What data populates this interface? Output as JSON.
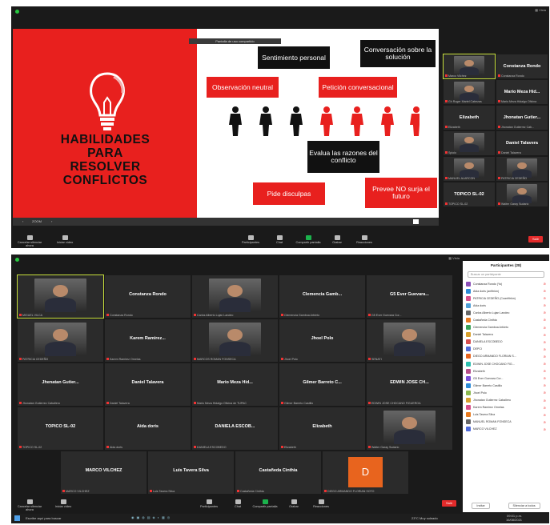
{
  "top": {
    "banner": "Pantalla de uso compartido",
    "slide": {
      "title_lines": [
        "HABILIDADES",
        "PARA",
        "RESOLVER",
        "CONFLICTOS"
      ],
      "boxes": {
        "sentimiento": "Sentimiento personal",
        "conversacion": "Conversación sobre la solución",
        "observacion": "Observación neutral",
        "peticion": "Petición conversacional",
        "evalua": "Evalua las razones del conflicto",
        "pide": "Pide disculpas",
        "prevee": "Prevee NO surja el futuro"
      }
    },
    "slidebar": {
      "zoom": "ZOOM"
    },
    "side_tiles": [
      {
        "name": "",
        "sub": "Marco Vilchez"
      },
      {
        "name": "Constanza Rondo",
        "sub": "Constanza Rondo"
      },
      {
        "name": "",
        "sub": "Gh Roger Martel Cabezas"
      },
      {
        "name": "Mario Meza Hid...",
        "sub": "Mario Meza Hidalgo Oficina"
      },
      {
        "name": "Elizabeth",
        "sub": "Elizabeth"
      },
      {
        "name": "Jhonatan Gutier...",
        "sub": "Jhonatan Gutierrez Cab..."
      },
      {
        "name": "",
        "sub": "Spiolo"
      },
      {
        "name": "Daniel Talavera",
        "sub": "Daniel Talavera"
      },
      {
        "name": "",
        "sub": "MANUEL ALARCON"
      },
      {
        "name": "",
        "sub": "PATRICIA CEDEÑO"
      },
      {
        "name": "TOPICO SL-02",
        "sub": "TOPICO SL-02"
      },
      {
        "name": "",
        "sub": "Walter Garay Sudario"
      }
    ],
    "toolbar": {
      "unmute": "Cancelar silenciar ahora",
      "start_video": "Iniciar vídeo",
      "participants": "Participantes",
      "chat": "Chat",
      "share": "Compartir pantalla",
      "record": "Grabar",
      "reactions": "Reacciones",
      "end": "Salir"
    }
  },
  "bottom": {
    "view": "Vista",
    "tiles": [
      {
        "name": "",
        "sub": "MIGUEL VILCA",
        "photo": true
      },
      {
        "name": "Constanza Rondo",
        "sub": "Constanza Rondo"
      },
      {
        "name": "",
        "sub": "Carlos Alberto Lujan Landeo",
        "photo": true
      },
      {
        "name": "Clemencia Gamb...",
        "sub": "Clemencia Gamboa Arbieto"
      },
      {
        "name": "G5 Ever Guevara...",
        "sub": "G5 Ever Guevara Cor..."
      },
      {
        "name": "",
        "sub": "PATRICIA CEDEÑO",
        "photo": true
      },
      {
        "name": "Karem Ramirez...",
        "sub": "Karem Ramirez Ornelas"
      },
      {
        "name": "",
        "sub": "MARCOS ROMAN FONSECA",
        "photo": true
      },
      {
        "name": "Jhoel Polo",
        "sub": "Jhoel Polo"
      },
      {
        "name": "",
        "sub": "SENATI",
        "photo": true
      },
      {
        "name": "Jhenatan Gutier...",
        "sub": "Jhonatan Gutierrez Caballero"
      },
      {
        "name": "Daniel Talavera",
        "sub": "Daniel Talavera"
      },
      {
        "name": "Mario Meza Hid...",
        "sub": "Mario Meza Hidalgo Oficina de TUPAC"
      },
      {
        "name": "Gilmer Barreto C...",
        "sub": "Gilmer Barreto Castillo"
      },
      {
        "name": "EDWIN JOSE CH...",
        "sub": "EDWIN JOSE CHOCANO FIGUEROA"
      },
      {
        "name": "TOPICO SL-02",
        "sub": "TOPICO SL-02"
      },
      {
        "name": "Aida doris",
        "sub": "Aida doris"
      },
      {
        "name": "DANIELA ESCOB...",
        "sub": "DANIELA ESCOBEDO"
      },
      {
        "name": "Elizabeth",
        "sub": "Elizabeth"
      },
      {
        "name": "",
        "sub": "Walter Garay Sudario",
        "photo": true
      },
      {
        "name": "MARCO VILCHEZ",
        "sub": "MARCO VILCHEZ"
      },
      {
        "name": "Luis Tavera Silva",
        "sub": "Luis Tavera Silva"
      },
      {
        "name": "Castañeda Cinthia",
        "sub": "Castañeda Cinthia"
      },
      {
        "name": "",
        "sub": "DIEGO ARMANDO FLORIAN SOTO",
        "letter": "D"
      }
    ],
    "panel": {
      "title": "Participantes (28)",
      "search": "Buscar un participante",
      "participants": [
        {
          "name": "Constanza Rondo (Yo)",
          "color": "#8b4fb8"
        },
        {
          "name": "Aida doris (anfitrión)",
          "color": "#2d8cd8"
        },
        {
          "name": "PATRICIA CEDEÑO (Coanfitrión)",
          "color": "#d84f8b"
        },
        {
          "name": "Aida doris",
          "color": "#4fa0d8"
        },
        {
          "name": "Carlos Alberto Lujan Landeo",
          "color": "#666"
        },
        {
          "name": "Castañeda Cinthia",
          "color": "#e87a1e"
        },
        {
          "name": "Clemencia Gamboa Arbieto",
          "color": "#3aa35a"
        },
        {
          "name": "Daniel Talavera",
          "color": "#d8a02d"
        },
        {
          "name": "DANIELA ESCOBEDO",
          "color": "#d84f4f"
        },
        {
          "name": "DEPCI",
          "color": "#4f6ad8"
        },
        {
          "name": "DIEGO ARMANDO FLORIAN S...",
          "color": "#e8641e"
        },
        {
          "name": "EDWIN JOSE CHOCANO FIG...",
          "color": "#2dc0b0"
        },
        {
          "name": "Elizabeth",
          "color": "#b84f8b"
        },
        {
          "name": "G5 Ever Guevara Cor...",
          "color": "#7a4fd8"
        },
        {
          "name": "Gilmer Barreto Castillo",
          "color": "#2d8cd8"
        },
        {
          "name": "Jhoel Polo",
          "color": "#8bb84f"
        },
        {
          "name": "Jhonatan Gutierrez Caballero",
          "color": "#d8a02d"
        },
        {
          "name": "Karem Ramirez Ornelas",
          "color": "#d84f8b"
        },
        {
          "name": "Luis Tavera Silva",
          "color": "#e87a1e"
        },
        {
          "name": "MANUEL ROMAN FONSECA",
          "color": "#666"
        },
        {
          "name": "MARCO VILCHEZ",
          "color": "#4f6ad8"
        }
      ],
      "invite": "Invitar",
      "mute_all": "Silenciar a todos"
    },
    "taskbar": {
      "search": "Escribe aquí para buscar",
      "weather": "23°C  Muy soleado",
      "time": "09:01 p.m.",
      "date": "16/08/2021"
    }
  }
}
